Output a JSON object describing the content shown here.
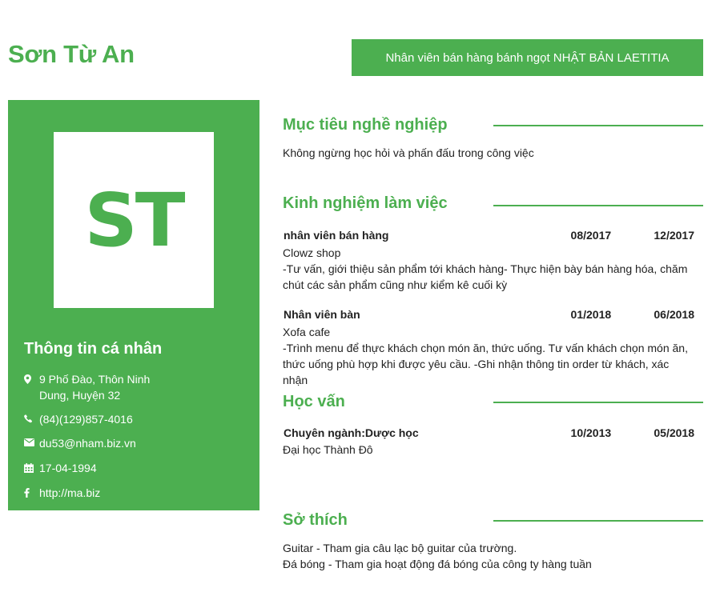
{
  "name": "Sơn Từ An",
  "job_title": "Nhân viên bán hàng bánh ngọt NHẬT BẢN LAETITIA",
  "avatar_initials": "ST",
  "personal_info": {
    "title": "Thông tin cá nhân",
    "address": "9 Phố Đào, Thôn Ninh Dung, Huyện 32",
    "phone": "(84)(129)857-4016",
    "email": "du53@nham.biz.vn",
    "birthday": "17-04-1994",
    "website": "http://ma.biz"
  },
  "objective": {
    "heading": "Mục tiêu nghề nghiệp",
    "text": "Không ngừng học hỏi và phấn đấu trong công việc"
  },
  "experience": {
    "heading": "Kinh nghiệm làm việc",
    "items": [
      {
        "title": "nhân viên bán hàng",
        "start": "08/2017",
        "end": "12/2017",
        "company": "Clowz shop",
        "description": "-Tư vấn, giới thiệu sản phẩm tới khách hàng- Thực hiện bày bán hàng hóa, chăm chút các sản phẩm cũng như kiểm kê cuối kỳ"
      },
      {
        "title": "Nhân viên bàn",
        "start": "01/2018",
        "end": "06/2018",
        "company": "Xofa cafe",
        "description": "-Trình menu để thực khách chọn món ăn, thức uống. Tư vấn khách chọn món ăn, thức uống phù hợp khi được yêu cầu. -Ghi nhận thông tin order từ khách, xác nhận"
      }
    ]
  },
  "education": {
    "heading": "Học vấn",
    "items": [
      {
        "title": "Chuyên ngành:Dược học",
        "start": "10/2013",
        "end": "05/2018",
        "school": "Đại học Thành Đô"
      }
    ]
  },
  "hobbies": {
    "heading": "Sở thích",
    "line1": "Guitar - Tham gia câu lạc bộ guitar của trường.",
    "line2": "Đá bóng - Tham gia hoạt động đá bóng của công ty hàng tuần"
  },
  "colors": {
    "accent": "#4caf50",
    "text": "#222222"
  }
}
